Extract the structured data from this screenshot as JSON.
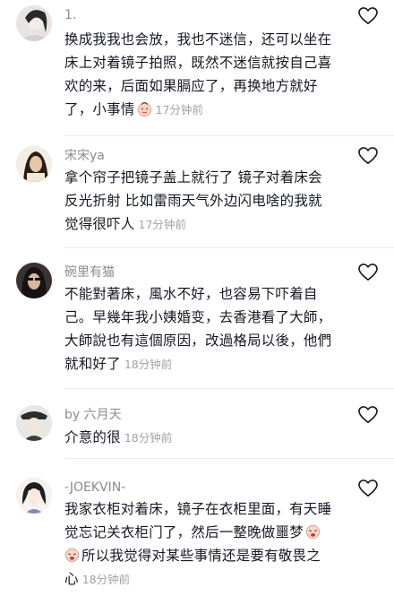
{
  "comments": [
    {
      "author": "1.",
      "lines": [
        "换成我我也会放，我也不迷信，还可以坐在",
        "床上对着镜子拍照，既然不迷信就按自己喜",
        "欢的来，后面如果膈应了，再换地方就好",
        "了，小事情"
      ],
      "time": "17分钟前",
      "emoji": "smiling-face-emoji"
    },
    {
      "author": "宋宋ya",
      "lines": [
        "拿个帘子把镜子盖上就行了 镜子对着床会",
        "反光折射 比如雷雨天气外边闪电啥的我就",
        "觉得很吓人"
      ],
      "time": "17分钟前"
    },
    {
      "author": "碗里有猫",
      "lines": [
        "不能對著床，風水不好，也容易下吓着自",
        "己。早幾年我小姨婚变，去香港看了大師，",
        "大師說也有這個原因，改過格局以後，他們",
        "就和好了"
      ],
      "time": "18分钟前"
    },
    {
      "author": "by 六月天",
      "lines": [
        "介意的很"
      ],
      "time": "18分钟前"
    },
    {
      "author": "-JOEKVIN-",
      "lines": [
        "我家衣柜对着床，镜子在衣柜里面，有天睡",
        "觉忘记关衣柜门了，然后一整晚做噩梦",
        "所以我觉得对某些事情还是要有敬畏之",
        "心"
      ],
      "time": "18分钟前",
      "emoji": "crying-face-emoji"
    }
  ],
  "icons": {
    "like": "heart-outline-icon"
  },
  "colors": {
    "text": "#161823",
    "author": "#8a8b91",
    "time": "#a1a2a7",
    "divider": "#ebebec"
  }
}
